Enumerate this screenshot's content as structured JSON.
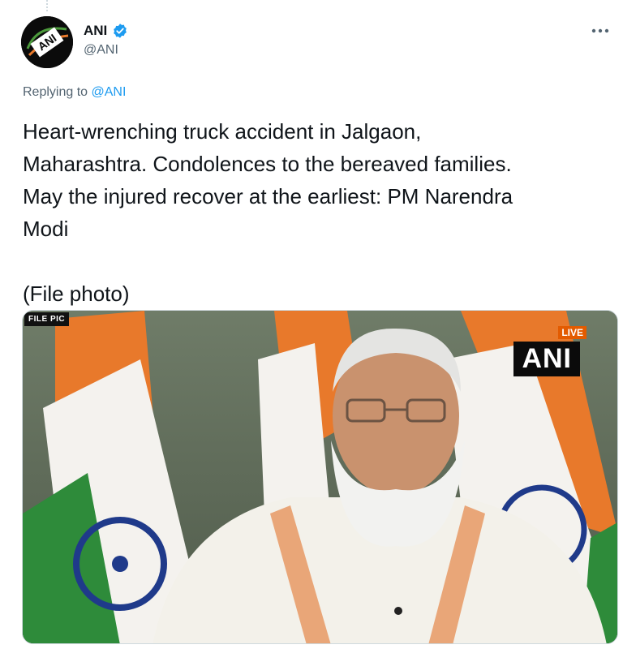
{
  "tweet": {
    "author": {
      "display_name": "ANI",
      "handle": "@ANI",
      "avatar_text": "ANI",
      "verified": true
    },
    "more_icon": "more-horizontal-icon",
    "replying_prefix": "Replying to ",
    "replying_handle": "@ANI",
    "text_lines": [
      "Heart-wrenching truck accident in Jalgaon,",
      "Maharashtra. Condolences to the bereaved families.",
      "May the injured recover at the earliest: PM Narendra",
      "Modi"
    ],
    "text_footer": "(File photo)",
    "media": {
      "file_pic_label": "FILE PIC",
      "live_label": "LIVE",
      "watermark": "ANI"
    }
  },
  "colors": {
    "text": "#0f1419",
    "secondary": "#536471",
    "link": "#1d9bf0",
    "verified": "#1d9bf0",
    "saffron": "#e8792b",
    "green": "#2e8b3a",
    "chakra": "#1f3a8a"
  }
}
